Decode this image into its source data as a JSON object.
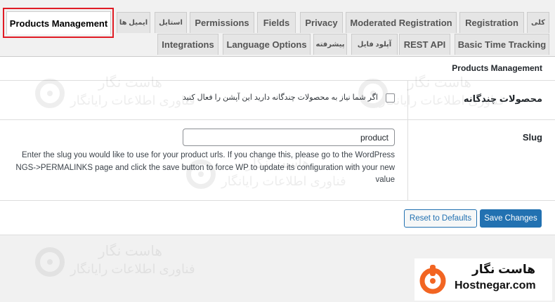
{
  "tabs_row1": [
    {
      "label": "Products Management",
      "active": true
    },
    {
      "label": "ایمیل ها"
    },
    {
      "label": "استایل"
    },
    {
      "label": "Permissions"
    },
    {
      "label": "Fields"
    },
    {
      "label": "Privacy"
    },
    {
      "label": "Moderated Registration"
    },
    {
      "label": "Registration"
    },
    {
      "label": "کلی"
    }
  ],
  "tabs_row2": [
    {
      "label": "Integrations"
    },
    {
      "label": "Language Options"
    },
    {
      "label": "پیشرفته"
    },
    {
      "label": "آپلود فایل"
    },
    {
      "label": "REST API"
    },
    {
      "label": "Basic Time Tracking"
    }
  ],
  "section": {
    "title": "Products Management"
  },
  "variable_products": {
    "label": "محصولات چندگانه",
    "checkbox_label": "اگر شما نیاز به محصولات چندگانه دارید این آپشن را فعال کنید",
    "checked": false
  },
  "slug": {
    "label": "Slug",
    "value": "product",
    "description_lines": [
      "Enter the slug you would like to use for your product urls. If you change this, please go to the WordPress",
      "NGS->PERMALINKS page and click the save button to force WP to update its configuration with your new",
      "value"
    ]
  },
  "buttons": {
    "reset": "Reset to Defaults",
    "save": "Save Changes"
  },
  "watermark": {
    "line1": "هاست نگار",
    "line2": "فناوری اطلاعات رایانگار"
  },
  "brand": {
    "name_fa": "هاست نگار",
    "name_en": "Hostnegar.com",
    "accent": "#f26522"
  },
  "colors": {
    "primary": "#2271b1",
    "highlight_border": "#e01b24"
  }
}
